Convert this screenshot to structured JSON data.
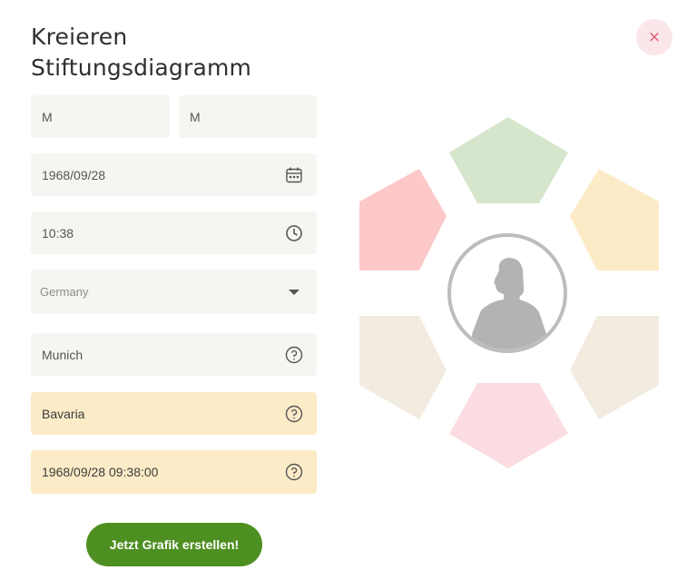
{
  "header": {
    "title_line1": "Kreieren",
    "title_line2": "Stiftungsdiagramm",
    "close_symbol": "×"
  },
  "form": {
    "first_name": "M",
    "last_name": "M",
    "birth_date": "1968/09/28",
    "birth_time": "10:38",
    "country": "Germany",
    "city": "Munich",
    "region": "Bavaria",
    "local_datetime": "1968/09/28 09:38:00",
    "submit_label": "Jetzt Grafik erstellen!"
  },
  "icons": {
    "birth_date": "calendar-icon",
    "birth_time": "clock-icon",
    "country": "caret-down-icon",
    "city": "help-icon",
    "region": "help-icon",
    "local_datetime": "help-icon",
    "chart_center": "person-silhouette-icon"
  },
  "colors": {
    "field_bg": "#f4f7f1",
    "field_warn_bg": "#fcebc7",
    "accent_green": "#4e8f22",
    "close_bg": "#fbe6ea",
    "close_fg": "#e05a73",
    "segment_top": "#d6e6cc",
    "segment_upper_right": "#fcebc7",
    "segment_lower_right": "#f2ebe0",
    "segment_bottom": "#fbdde1",
    "segment_lower_left": "#f2ebe0",
    "segment_upper_left": "#fcc9c8"
  }
}
